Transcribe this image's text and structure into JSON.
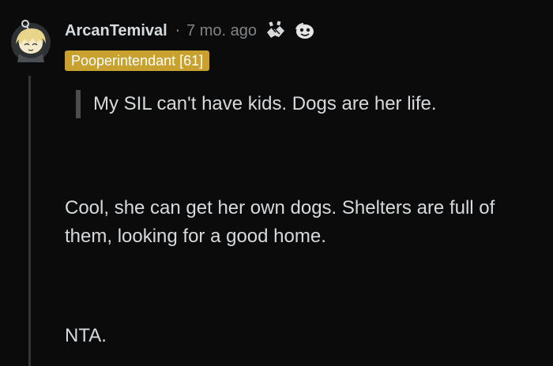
{
  "comment": {
    "author": "ArcanTemival",
    "separator": "·",
    "time": "7 mo. ago",
    "awards": [
      "handshake-icon",
      "face-icon"
    ],
    "flair": "Pooperintendant [61]",
    "quote": "My SIL can't have kids. Dogs are her life.",
    "body": [
      [
        "Cool, she can get her own dogs. Shelters are full of",
        "them, looking for a good home."
      ],
      [
        "NTA."
      ]
    ]
  },
  "colors": {
    "background": "#0b0b0c",
    "text": "#d7dadc",
    "muted": "#818384",
    "flair": "#c8a12f",
    "thread_line": "#343536",
    "quote_bar": "#4b4d4f"
  }
}
